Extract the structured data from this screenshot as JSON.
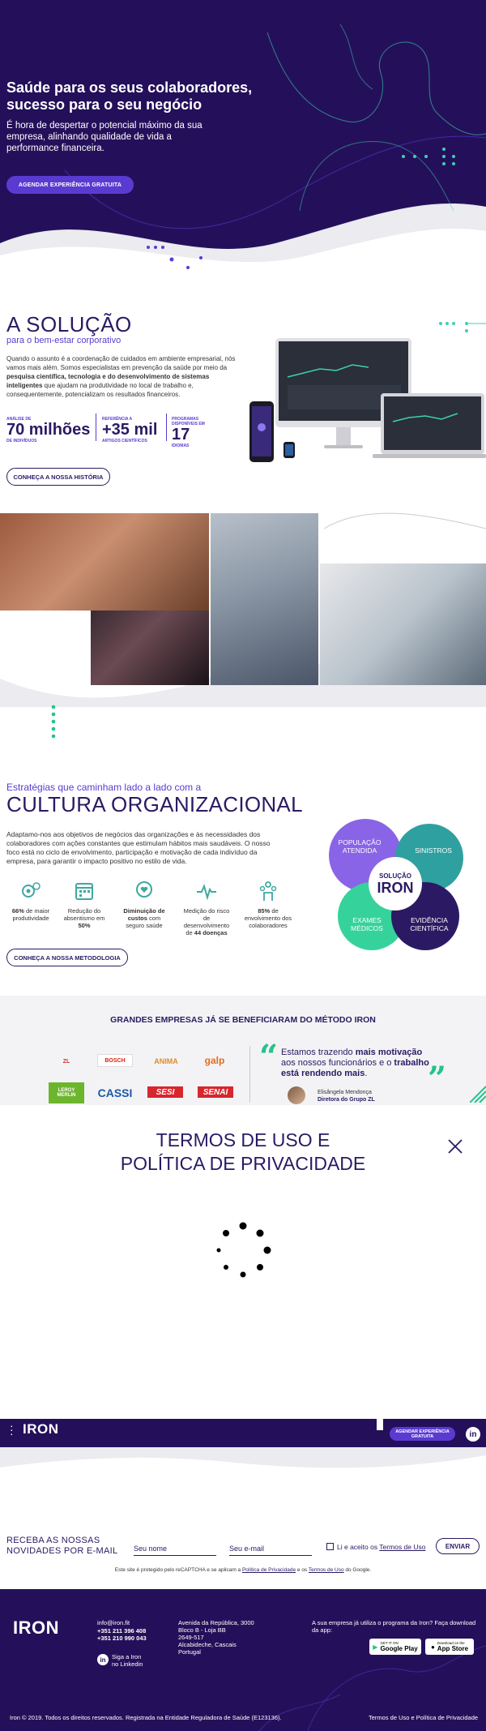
{
  "hero": {
    "title": "Saúde para os seus colaboradores, sucesso para o seu negócio",
    "subtitle": "É hora de despertar o potencial máximo da sua empresa, alinhando qualidade de vida a performance financeira.",
    "cta": "AGENDAR EXPERIÊNCIA GRATUITA"
  },
  "solucao": {
    "title": "A SOLUÇÃO",
    "subtitle": "para o bem-estar corporativo",
    "text_1": "Quando o assunto é a coordenação de cuidados em ambiente empresarial, nós vamos mais além. Somos especialistas em prevenção da saúde por meio da ",
    "text_bold": "pesquisa científica, tecnologia e do desenvolvimento de sistemas inteligentes",
    "text_2": " que ajudam na produtividade no local de trabalho e, consequentemente, potencializam os resultados financeiros.",
    "stats": [
      {
        "label": "ANÁLISE DE",
        "value": "70 milhões",
        "unit": "DE INDIVÍDUOS"
      },
      {
        "label": "REFERÊNCIA A",
        "value": "+35 mil",
        "unit": "ARTIGOS CIENTÍFICOS"
      },
      {
        "label": "PROGRAMAS DISPONÍVEIS EM",
        "value": "17",
        "unit": "IDIOMAS"
      }
    ],
    "cta": "CONHEÇA A NOSSA HISTÓRIA"
  },
  "cultura": {
    "pre": "Estratégias que caminham lado a lado com a",
    "title": "CULTURA ORGANIZACIONAL",
    "text": "Adaptamo-nos aos objetivos de negócios das organizações e às necessidades dos colaboradores com ações constantes que estimulam hábitos mais saudáveis. O nosso foco está no ciclo de envolvimento, participação e motivação de cada indivíduo da empresa, para garantir o impacto positivo no estilo de vida.",
    "features": [
      {
        "pre": "",
        "bold": "66%",
        "post": " de maior produtividade"
      },
      {
        "pre": "Redução do absentismo em ",
        "bold": "50%",
        "post": ""
      },
      {
        "pre": "",
        "bold": "Diminuição de custos",
        "post": " com seguro saúde"
      },
      {
        "pre": "Medição do risco de desenvolvimento de ",
        "bold": "44 doenças",
        "post": ""
      },
      {
        "pre": "",
        "bold": "85%",
        "post": " de envolvimento dos colaboradores"
      }
    ],
    "bubbles": {
      "populacao": "POPULAÇÃO ATENDIDA",
      "sinistros": "SINISTROS",
      "exames": "EXAMES MÉDICOS",
      "evidencia": "EVIDÊNCIA CIENTÍFICA",
      "center_top": "SOLUÇÃO",
      "center_bottom": "IRON"
    },
    "cta": "CONHEÇA A NOSSA METODOLOGIA"
  },
  "empresas": {
    "title": "GRANDES EMPRESAS JÁ SE BENEFICIARAM DO MÉTODO IRON",
    "logos": [
      "ZL",
      "BOSCH",
      "ANIMA",
      "galp",
      "LEROY MERLIN",
      "CASSI",
      "SESI",
      "SENAI"
    ],
    "quote_1": "Estamos trazendo ",
    "quote_b1": "mais motivação",
    "quote_2": " aos nossos funcionários e o ",
    "quote_b2": "trabalho está rendendo mais",
    "quote_3": ".",
    "author": "Elisângela Mendonça",
    "role": "Diretora do Grupo ZL"
  },
  "modal": {
    "title_1": "TERMOS DE USO E",
    "title_2": "POLÍTICA DE PRIVACIDADE"
  },
  "nav": {
    "logo": "IRON",
    "cta": "AGENDAR EXPERIÊNCIA GRATUITA",
    "linkedin": "in"
  },
  "newsletter": {
    "title_1": "RECEBA AS NOSSAS",
    "title_2": "NOVIDADES POR E-MAIL",
    "name_placeholder": "Seu nome",
    "email_placeholder": "Seu e-mail",
    "accept": "Li e aceito os ",
    "accept_link": "Termos de Uso",
    "send": "ENVIAR",
    "recaptcha_1": "Este site é protegido pelo reCAPTCHA e se aplicam a ",
    "recaptcha_link1": "Política de Privacidade",
    "recaptcha_2": " e os ",
    "recaptcha_link2": "Termos de Uso",
    "recaptcha_3": " do Google."
  },
  "footer": {
    "logo": "IRON",
    "email": "info@iron.fit",
    "phone1": "+351 211 396 408",
    "phone2": "+351 210 990 043",
    "linkedin_1": "Siga a Iron",
    "linkedin_2": "no Linkedin",
    "address": [
      "Avenida da República, 3000",
      "Bloco B - Loja BB",
      "2649-517",
      "Alcabideche, Cascais",
      "Portugal"
    ],
    "app_text": "A sua empresa já utiliza o programa da Iron? Faça download da app:",
    "google_small": "GET IT ON",
    "google": "Google Play",
    "apple_small": "Download on the",
    "apple": "App Store",
    "copyright": "Iron © 2019. Todos os direitos reservados. Registrada na Entidade Reguladora de Saúde (E123136).",
    "terms": "Termos de Uso e Política de Privacidade"
  }
}
